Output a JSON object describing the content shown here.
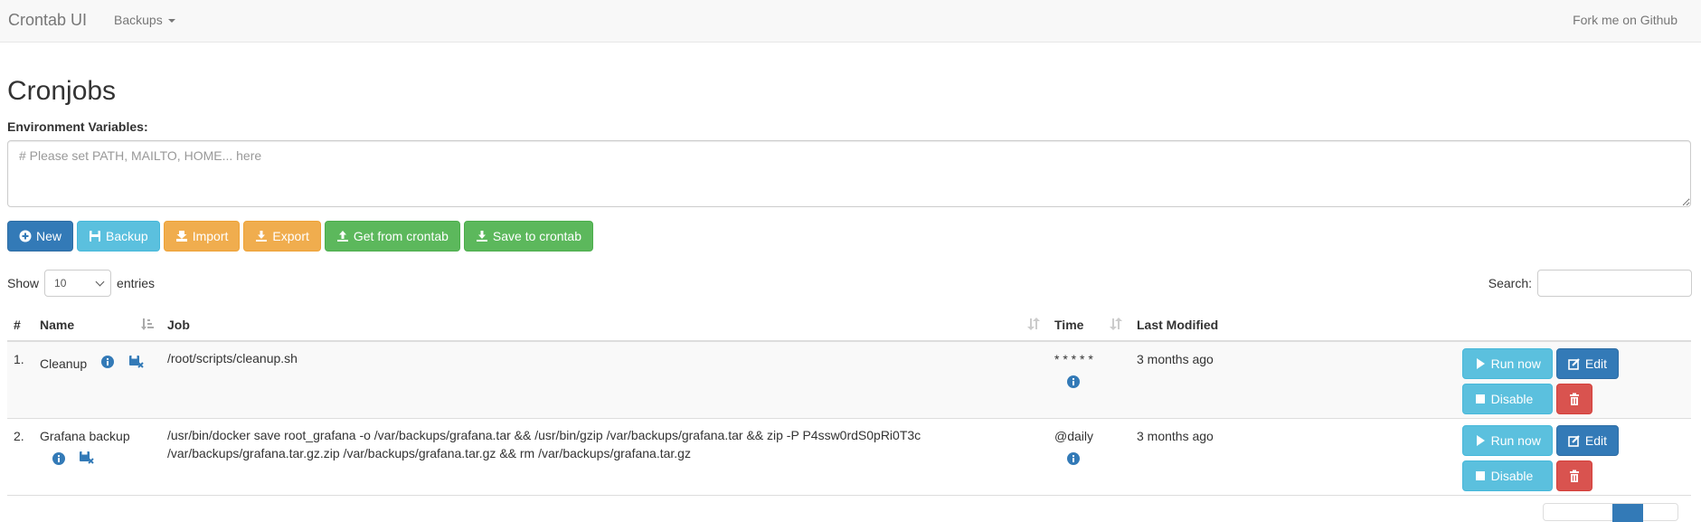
{
  "navbar": {
    "brand": "Crontab UI",
    "backups_label": "Backups",
    "fork_label": "Fork me on Github"
  },
  "page": {
    "title": "Cronjobs",
    "env_label": "Environment Variables:",
    "env_placeholder": "# Please set PATH, MAILTO, HOME... here"
  },
  "toolbar": {
    "new": "New",
    "backup": "Backup",
    "import": "Import",
    "export": "Export",
    "get_from_crontab": "Get from crontab",
    "save_to_crontab": "Save to crontab"
  },
  "table_controls": {
    "show_label": "Show",
    "page_length": "10",
    "entries_label": "entries",
    "search_label": "Search:"
  },
  "table": {
    "headers": {
      "num": "#",
      "name": "Name",
      "job": "Job",
      "time": "Time",
      "last_modified": "Last Modified"
    },
    "rows": [
      {
        "num": "1.",
        "name": "Cleanup",
        "job": "/root/scripts/cleanup.sh",
        "time": "* * * * *",
        "last_modified": "3 months ago",
        "run_label": "Run now",
        "edit_label": "Edit",
        "disable_label": "Disable"
      },
      {
        "num": "2.",
        "name": "Grafana backup",
        "job": "/usr/bin/docker save root_grafana -o /var/backups/grafana.tar && /usr/bin/gzip /var/backups/grafana.tar && zip -P P4ssw0rdS0pRi0T3c /var/backups/grafana.tar.gz.zip /var/backups/grafana.tar.gz && rm /var/backups/grafana.tar.gz",
        "time": "@daily",
        "last_modified": "3 months ago",
        "run_label": "Run now",
        "edit_label": "Edit",
        "disable_label": "Disable"
      }
    ]
  },
  "colors": {
    "primary": "#337ab7",
    "info": "#5bc0de",
    "warning": "#f0ad4e",
    "success": "#5cb85c",
    "danger": "#d9534f"
  }
}
